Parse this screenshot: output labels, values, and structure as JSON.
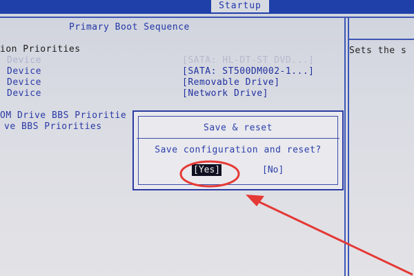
{
  "top_tab": {
    "label": "Startup"
  },
  "main": {
    "section_title": "Primary Boot Sequence",
    "heading": "ion Priorities",
    "rows": [
      {
        "label": "Device",
        "value": "[SATA: HL-DT-ST DVD...]",
        "dimmed": true
      },
      {
        "label": "Device",
        "value": "[SATA: ST500DM002-1...]",
        "dimmed": false
      },
      {
        "label": "Device",
        "value": "[Removable Drive]",
        "dimmed": false
      },
      {
        "label": "Device",
        "value": "[Network Drive]",
        "dimmed": false
      }
    ],
    "submenus": [
      {
        "label": "OM Drive BBS Prioritie"
      },
      {
        "label": "ve BBS Priorities"
      }
    ]
  },
  "help_panel": {
    "text": "Sets the s"
  },
  "dialog": {
    "title": "Save & reset",
    "message": "Save configuration and reset?",
    "yes_label": "[Yes]",
    "no_label": "[No]"
  },
  "colors": {
    "bios_blue": "#1f3fa9",
    "highlight_annotation": "#e53935"
  }
}
